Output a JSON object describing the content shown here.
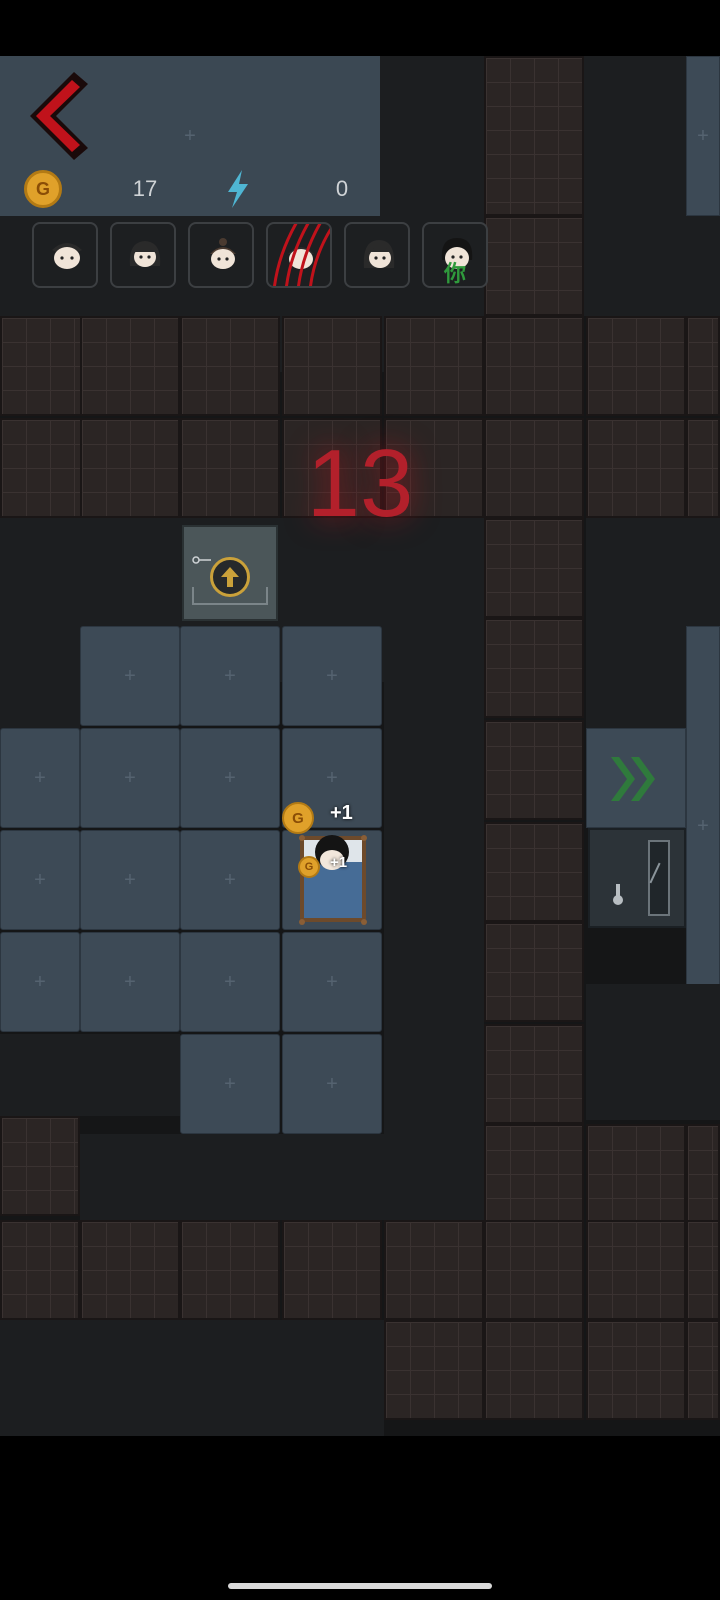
{
  "hud": {
    "gold_symbol": "G",
    "gold_count": "17",
    "energy_count": "0"
  },
  "characters": [
    {
      "icon": "boy-face-icon"
    },
    {
      "icon": "bob-hair-face-icon"
    },
    {
      "icon": "bun-hair-face-icon"
    },
    {
      "icon": "claw-scratched-face-icon",
      "state": "attacked"
    },
    {
      "icon": "long-hair-face-icon"
    },
    {
      "icon": "player-face-icon",
      "label": "你"
    }
  ],
  "countdown": "13",
  "float_gain": {
    "big": "+1",
    "small": "+1"
  },
  "colors": {
    "back_arrow": "#c0121b",
    "countdown": "#b3202b",
    "coin": "#e0a12a",
    "energy_bolt": "#4fb6d3",
    "exit_chevrons": "#2f7a3c"
  }
}
